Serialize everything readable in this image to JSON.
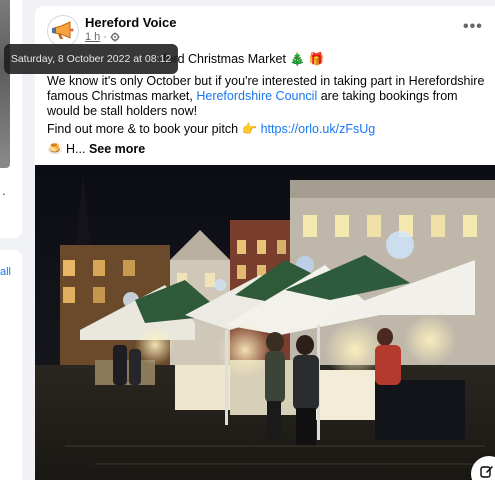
{
  "post": {
    "page_name": "Hereford Voice",
    "time": "1 h",
    "separator": "·",
    "intro_visible": "ford Christmas Market",
    "intro_emoji": "🎄 🎁",
    "body_pre": "We know it's only October but if you're interested in taking part in Herefordshire famous Christmas market, ",
    "body_link": "Herefordshire Council",
    "body_post": " are taking bookings from would be stall holders now!",
    "pitch_text": "Find out more & to book your pitch 👉 ",
    "pitch_link": "https://orlo.uk/zFsUg",
    "truncated": "🍮 H... ",
    "see_more": "See more"
  },
  "tooltip": {
    "text": "Saturday, 8 October 2022 at 08:12"
  },
  "left_sidebar": {
    "link_text": "all"
  },
  "icons": {
    "avatar": "megaphone-icon",
    "privacy": "globe-icon",
    "more": "more-options-icon",
    "compose": "compose-icon"
  },
  "colors": {
    "link": "#1877f2",
    "text": "#050505",
    "secondary": "#65676b",
    "background": "#f0f2f5"
  }
}
